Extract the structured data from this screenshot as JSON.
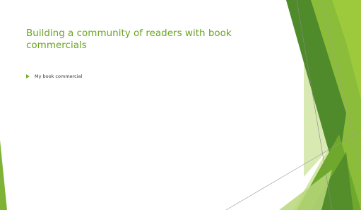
{
  "slide": {
    "title": "Building a community of readers with book commercials",
    "bullets": [
      {
        "text": "My book commercial"
      }
    ]
  },
  "colors": {
    "title": "#6aa521",
    "accent_dark": "#4f8a2b",
    "accent_mid": "#7fb336",
    "accent_light": "#a5cc4f",
    "accent_pale": "#d4e8a8",
    "body_text": "#333333"
  }
}
